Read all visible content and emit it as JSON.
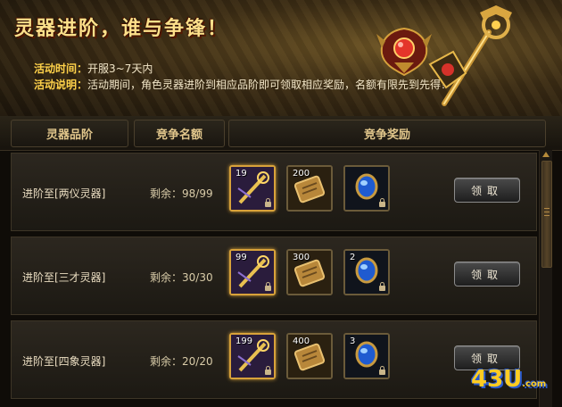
{
  "banner": {
    "title": "灵器进阶，谁与争锋！",
    "time_label": "活动时间：",
    "time_value": "开服3~7天内",
    "desc_label": "活动说明：",
    "desc_value": "活动期间，角色灵器进阶到相应品阶即可领取相应奖励，名额有限先到先得！"
  },
  "headers": {
    "col1": "灵器品阶",
    "col2": "竞争名额",
    "col3": "竞争奖励"
  },
  "rows": [
    {
      "label": "进阶至[两仪灵器]",
      "remain": "剩余：98/99",
      "r1_count": "19",
      "r2_count": "200",
      "r3_count": "",
      "button": "领取"
    },
    {
      "label": "进阶至[三才灵器]",
      "remain": "剩余：30/30",
      "r1_count": "99",
      "r2_count": "300",
      "r3_count": "2",
      "button": "领取"
    },
    {
      "label": "进阶至[四象灵器]",
      "remain": "剩余：20/20",
      "r1_count": "199",
      "r2_count": "400",
      "r3_count": "3",
      "button": "领取"
    }
  ],
  "watermark": {
    "main": "43U",
    "suffix": ".com"
  },
  "colors": {
    "gold": "#d8a23a",
    "title": "#ffe08a",
    "label": "#ffd24a"
  }
}
